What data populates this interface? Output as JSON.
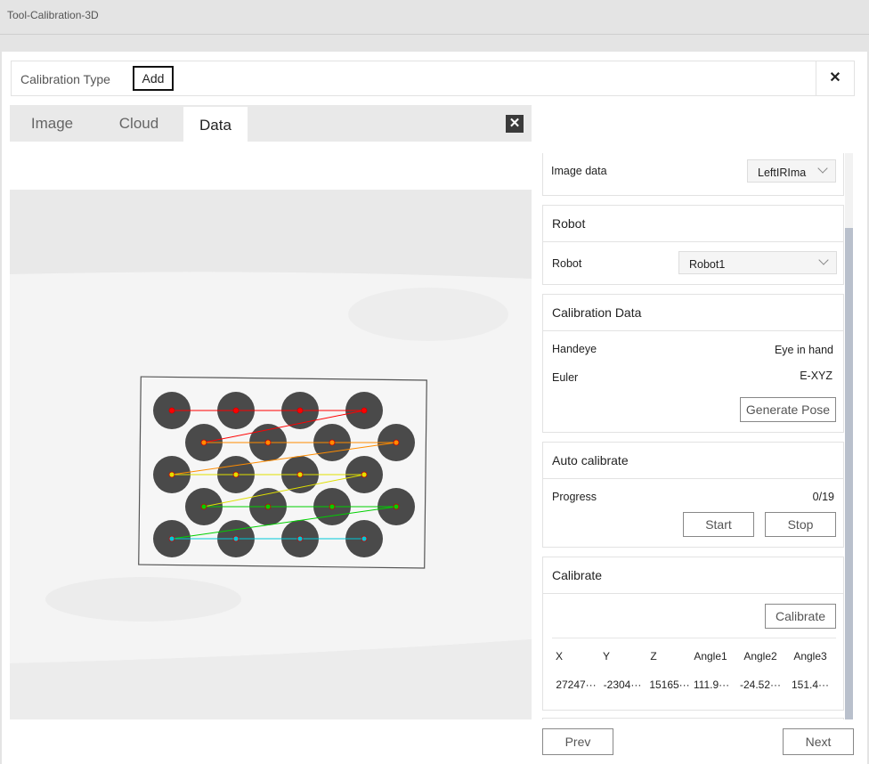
{
  "window": {
    "title": "Tool-Calibration-3D"
  },
  "calibration_bar": {
    "label": "Calibration Type",
    "add_label": "Add",
    "close_glyph": "✕"
  },
  "viewer": {
    "tabs": [
      {
        "label": "Image"
      },
      {
        "label": "Cloud"
      },
      {
        "label": "Data"
      }
    ],
    "active_tab": "Data",
    "close_glyph": "✕"
  },
  "image_data": {
    "label": "Image data",
    "value": "LeftIRIma"
  },
  "robot": {
    "title": "Robot",
    "label": "Robot",
    "value": "Robot1"
  },
  "calibration_data": {
    "title": "Calibration Data",
    "handeye_label": "Handeye",
    "handeye_value": "Eye in hand",
    "euler_label": "Euler",
    "euler_value": "E-XYZ",
    "generate_label": "Generate Pose"
  },
  "auto_calibrate": {
    "title": "Auto calibrate",
    "progress_label": "Progress",
    "progress_value": "0/19",
    "start_label": "Start",
    "stop_label": "Stop"
  },
  "calibrate": {
    "title": "Calibrate",
    "button_label": "Calibrate",
    "headers": [
      "X",
      "Y",
      "Z",
      "Angle1",
      "Angle2",
      "Angle3"
    ],
    "values": [
      "27247···",
      "-2304···",
      "15165···",
      "111.9···",
      "-24.52···",
      "151.4···"
    ]
  },
  "footer": {
    "prev_label": "Prev",
    "next_label": "Next"
  },
  "colors": {
    "grid_rows": [
      "#ff0000",
      "#ff8c00",
      "#e0e000",
      "#00d000",
      "#00c8d8"
    ]
  }
}
